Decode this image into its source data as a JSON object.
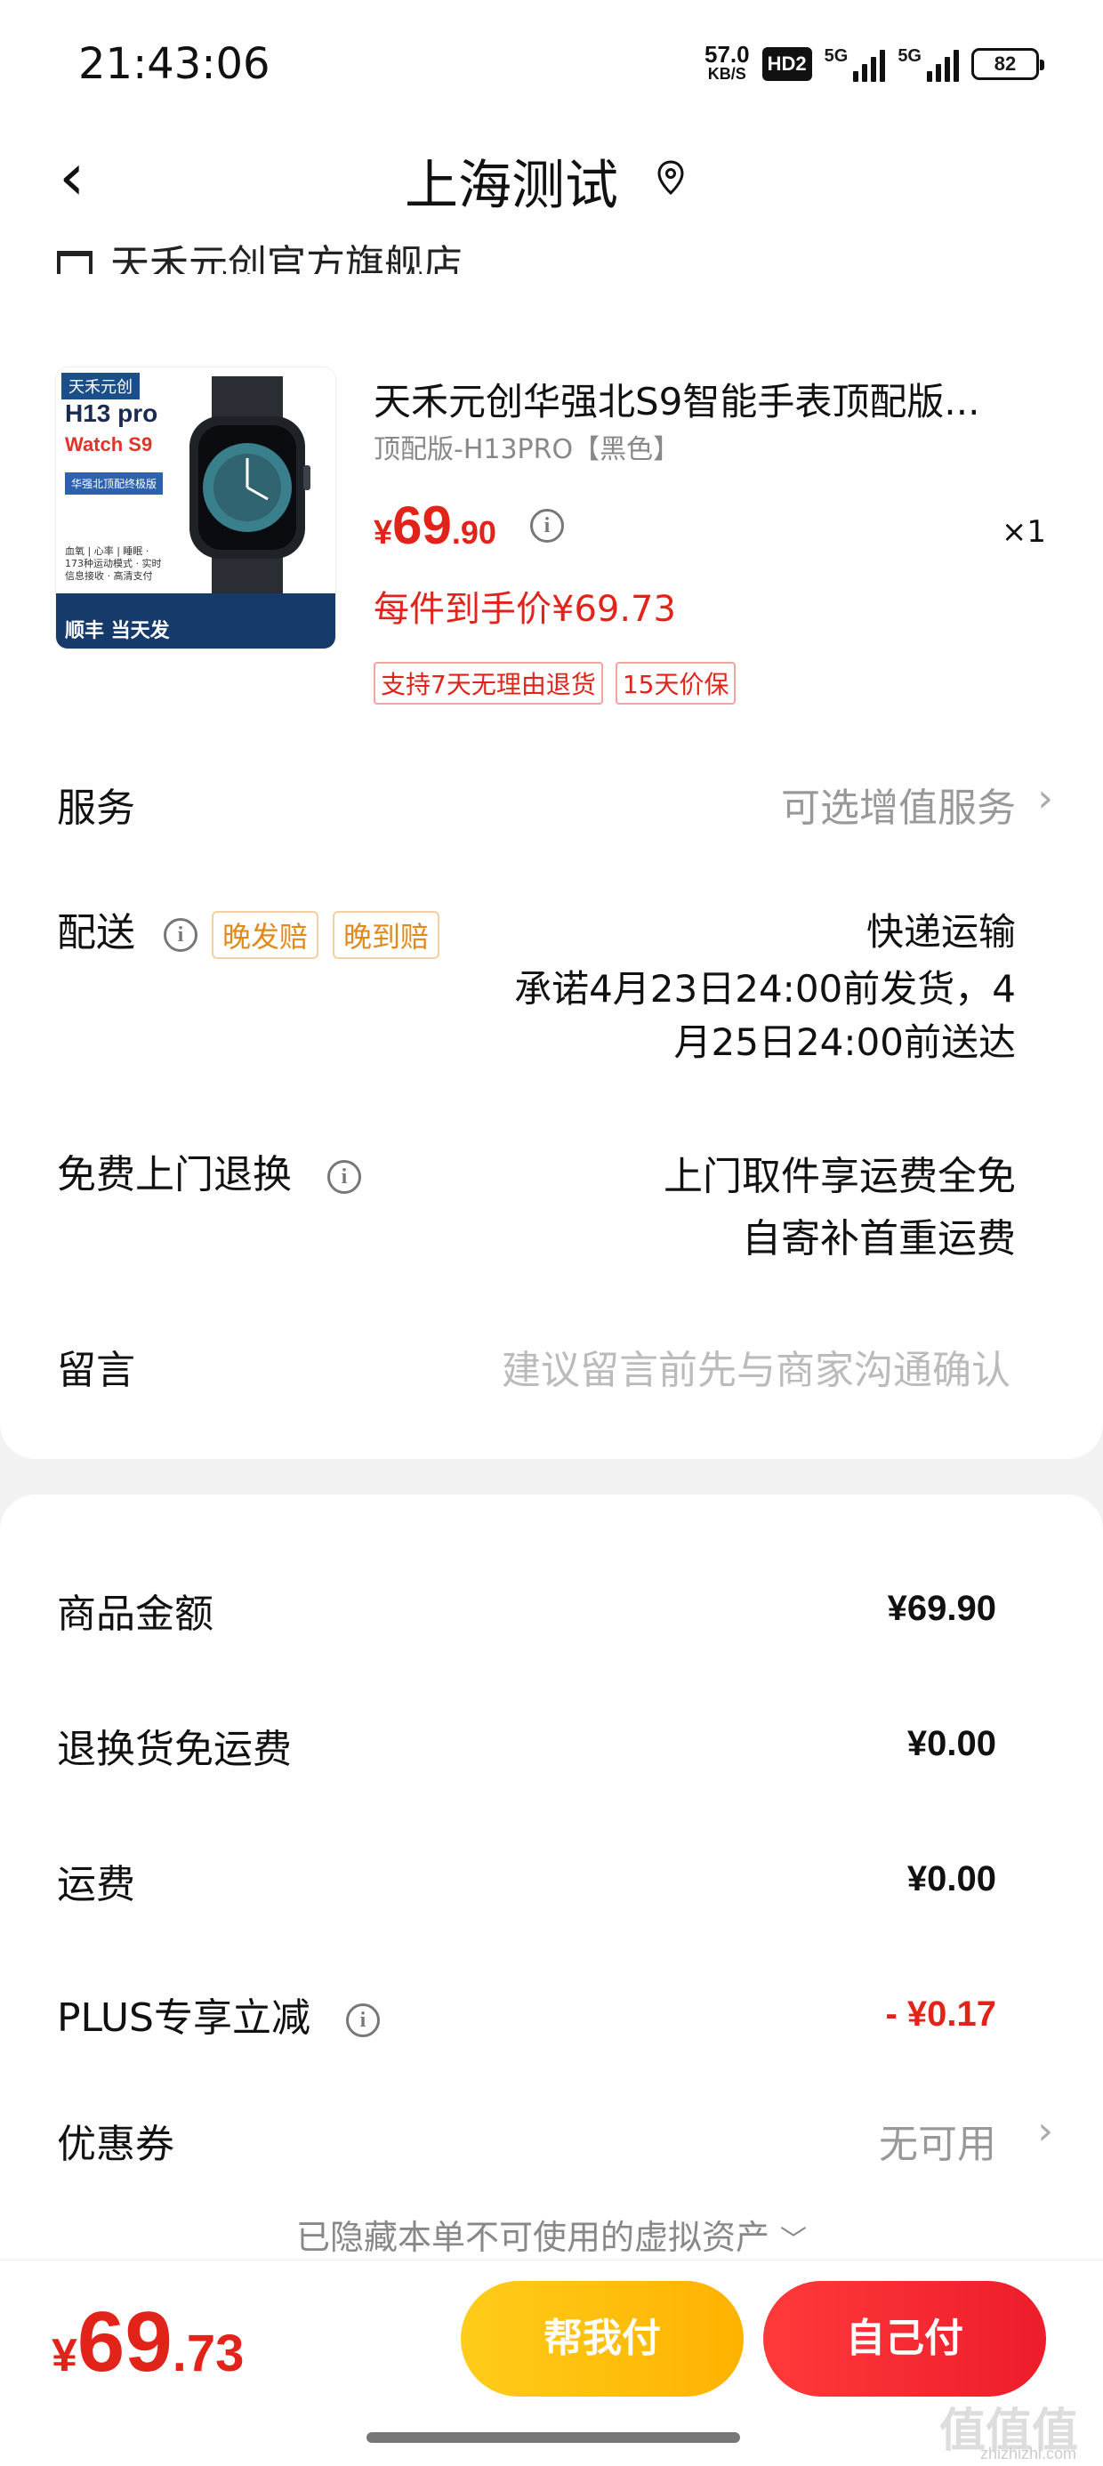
{
  "status_bar": {
    "time": "21:43:06",
    "net_speed": "57.0",
    "net_unit": "KB/S",
    "hd": "HD2",
    "sig1": "5G",
    "sig2": "5G",
    "battery": "82"
  },
  "header": {
    "title": "上海测试",
    "back_icon": "chevron-left-icon",
    "location_icon": "location-pin-icon"
  },
  "store": {
    "name": "天禾元创官方旗舰店",
    "icon": "store-icon"
  },
  "product": {
    "image_text": {
      "brand": "天禾元创",
      "model1": "H13 pro",
      "model2": "Watch S9",
      "label": "华强北顶配终极版",
      "features": "血氧 | 心率 | 睡眠 · 173种运动模式 · 实时信息接收 · 高清支付",
      "shipping": "顺丰 当天发"
    },
    "title": "天禾元创华强北S9智能手表顶配版...",
    "spec": "顶配版-H13PRO【黑色】",
    "price_symbol": "¥",
    "price_int": "69",
    "price_dec": ".90",
    "quantity": "×1",
    "unit_price": "每件到手价¥69.73",
    "tags": [
      "支持7天无理由退货",
      "15天价保"
    ]
  },
  "service": {
    "label": "服务",
    "value": "可选增值服务"
  },
  "delivery": {
    "label": "配送",
    "tags": [
      "晚发赔",
      "晚到赔"
    ],
    "method": "快递运输",
    "promise_line1": "承诺4月23日24:00前发货，4",
    "promise_line2": "月25日24:00前送达"
  },
  "free_return": {
    "label": "免费上门退换",
    "line1": "上门取件享运费全免",
    "line2": "自寄补首重运费"
  },
  "message": {
    "label": "留言",
    "placeholder": "建议留言前先与商家沟通确认"
  },
  "costs": {
    "goods_label": "商品金额",
    "goods_value": "¥69.90",
    "return_label": "退换货免运费",
    "return_value": "¥0.00",
    "shipping_label": "运费",
    "shipping_value": "¥0.00",
    "plus_label": "PLUS专享立减",
    "plus_value": "- ¥0.17",
    "coupon_label": "优惠券",
    "coupon_value": "无可用"
  },
  "hidden_assets": "已隐藏本单不可使用的虚拟资产",
  "bottom": {
    "total_symbol": "¥",
    "total_int": "69",
    "total_dec": ".73",
    "friend_pay": "帮我付",
    "self_pay": "自己付"
  },
  "watermark": {
    "text": "值值值",
    "sub": "zhizhizhi.com"
  },
  "colors": {
    "accent_red": "#e2231a",
    "gold": "#ffc107",
    "orange_tag": "#e08a1e"
  }
}
